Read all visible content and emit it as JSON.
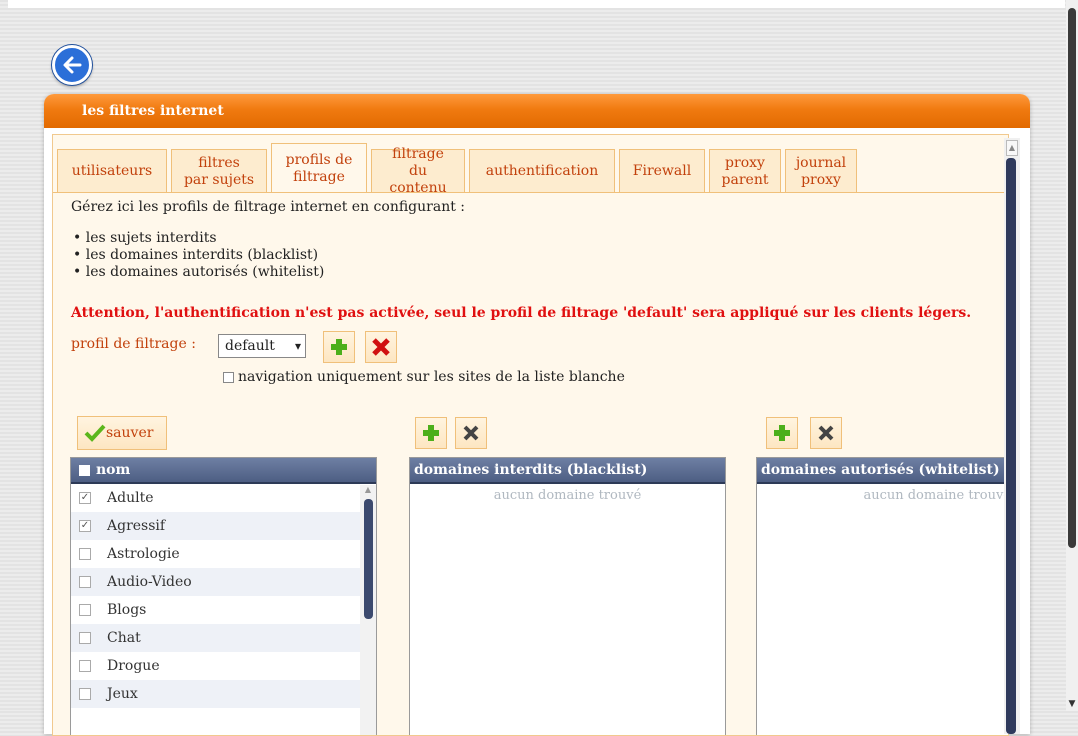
{
  "window": {
    "title": "les filtres internet"
  },
  "tabs": [
    {
      "line1": "utilisateurs",
      "line2": ""
    },
    {
      "line1": "filtres",
      "line2": "par sujets"
    },
    {
      "line1": "profils de",
      "line2": "filtrage"
    },
    {
      "line1": "filtrage du",
      "line2": "contenu"
    },
    {
      "line1": "authentification",
      "line2": ""
    },
    {
      "line1": "Firewall",
      "line2": ""
    },
    {
      "line1": "proxy",
      "line2": "parent"
    },
    {
      "line1": "journal",
      "line2": "proxy"
    }
  ],
  "intro": "Gérez ici les profils de filtrage internet en configurant :",
  "bullets": [
    "les sujets interdits",
    "les domaines interdits (blacklist)",
    "les domaines autorisés (whitelist)"
  ],
  "warning": "Attention, l'authentification n'est pas activée, seul le profil de filtrage 'default' sera appliqué sur les clients légers.",
  "profile": {
    "label": "profil de filtrage :",
    "selected": "default"
  },
  "nav_checkbox_label": "navigation uniquement sur les sites de la liste blanche",
  "save_label": "sauver",
  "subjects": {
    "header": "nom",
    "rows": [
      {
        "name": "Adulte",
        "checked": true
      },
      {
        "name": "Agressif",
        "checked": true
      },
      {
        "name": "Astrologie",
        "checked": false
      },
      {
        "name": "Audio-Video",
        "checked": false
      },
      {
        "name": "Blogs",
        "checked": false
      },
      {
        "name": "Chat",
        "checked": false
      },
      {
        "name": "Drogue",
        "checked": false
      },
      {
        "name": "Jeux",
        "checked": false
      }
    ]
  },
  "blacklist": {
    "header": "domaines interdits (blacklist)",
    "empty": "aucun domaine trouvé"
  },
  "whitelist": {
    "header": "domaines autorisés (whitelist)",
    "empty": "aucun domaine trouvé"
  },
  "colors": {
    "accent": "#f07a10",
    "tab_text": "#c2410c",
    "warning": "#e01010",
    "panel_header": "#5a6b8f"
  }
}
